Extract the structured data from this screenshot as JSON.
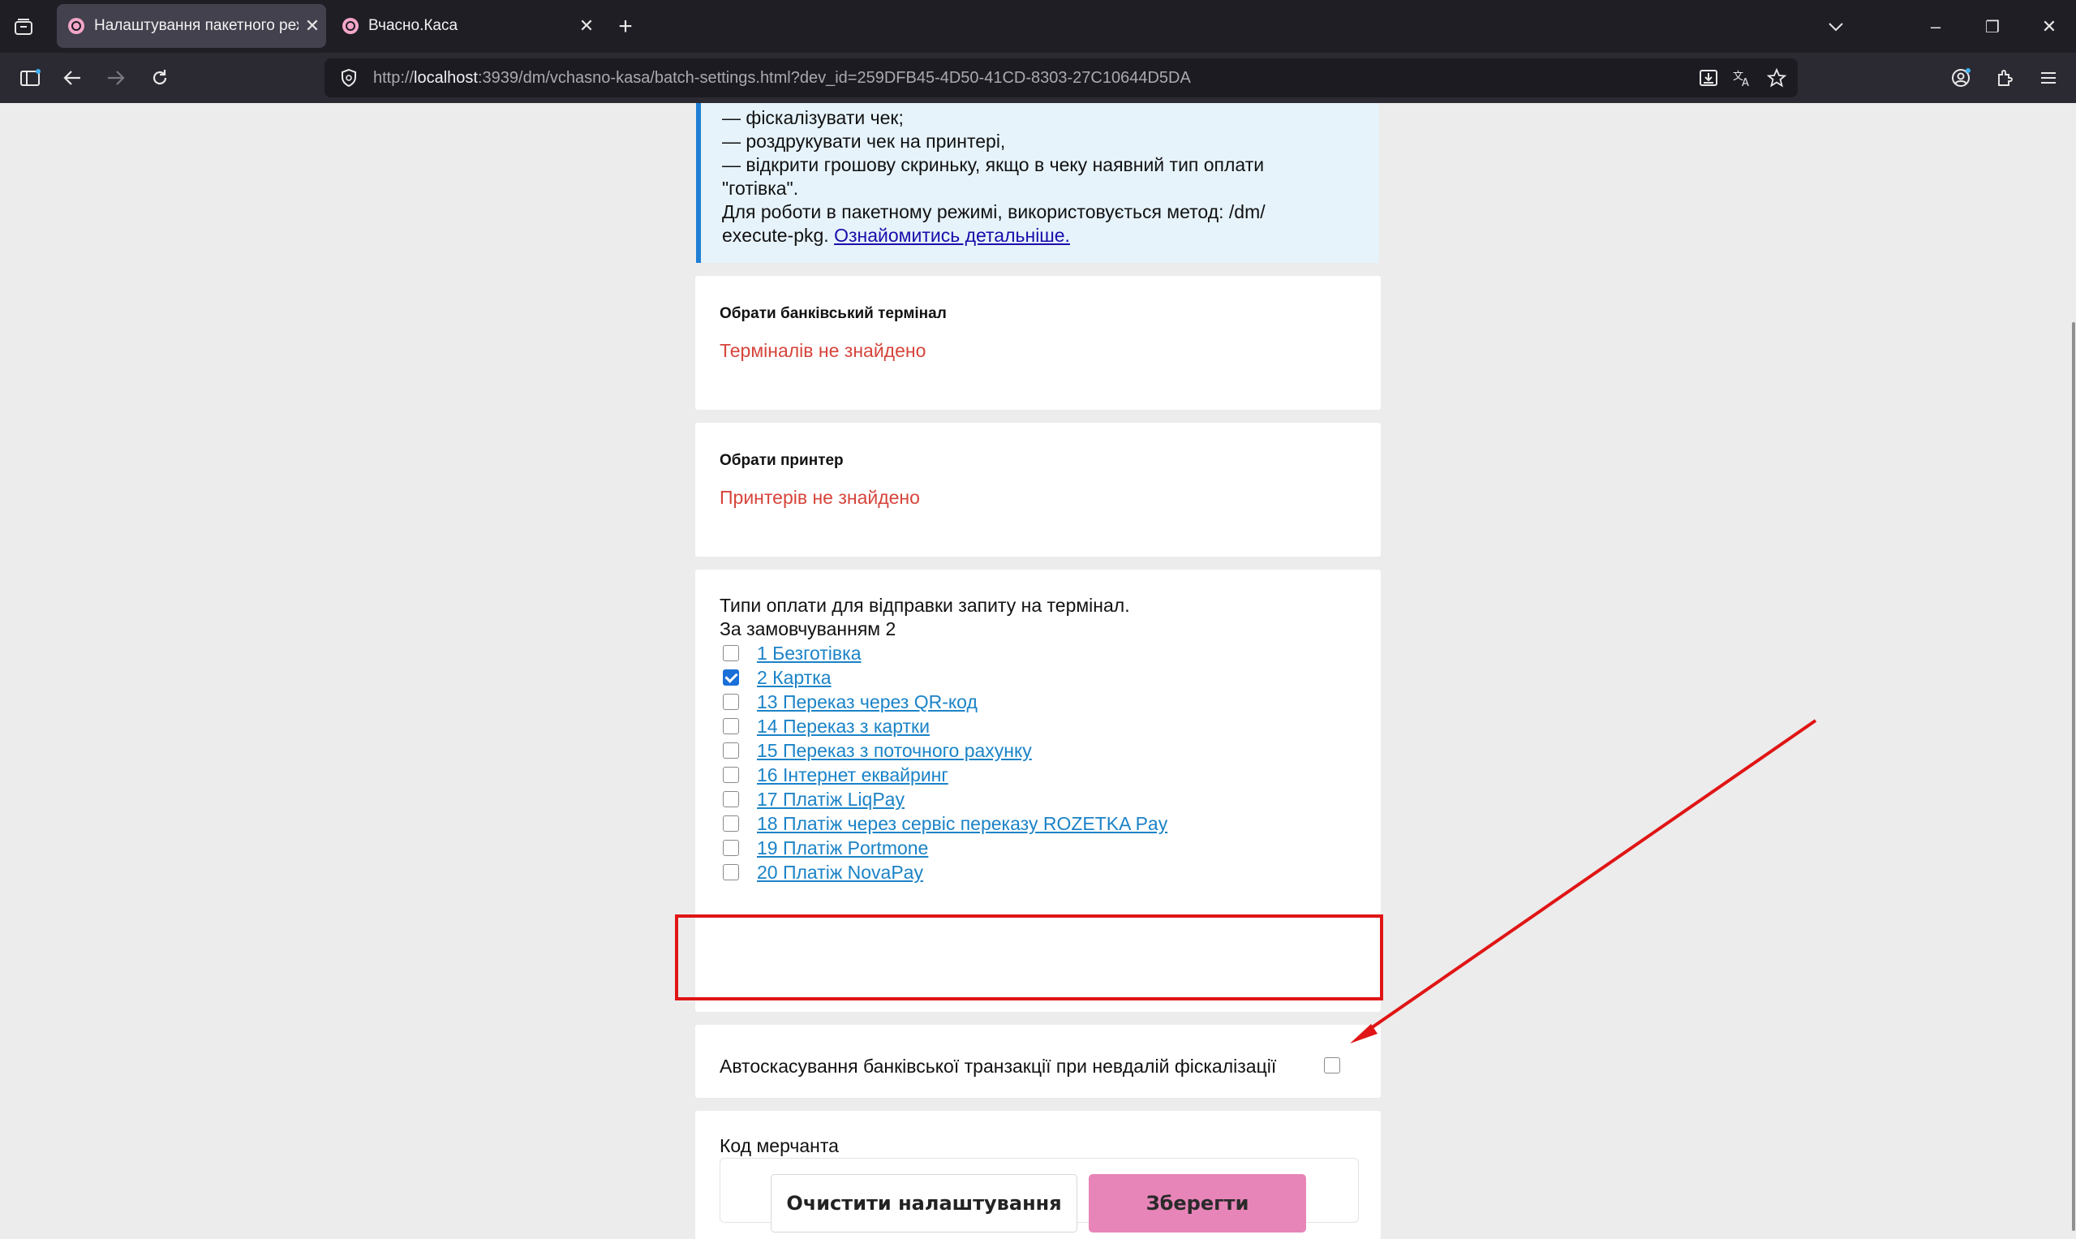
{
  "browser": {
    "tabs": [
      {
        "title": "Налаштування пакетного режи",
        "active": true
      },
      {
        "title": "Вчасно.Каса",
        "active": false
      }
    ],
    "new_tab_label": "+",
    "url": {
      "scheme": "http://",
      "host": "localhost",
      "rest": ":3939/dm/vchasno-kasa/batch-settings.html?dev_id=259DFB45-4D50-41CD-8303-27C10644D5DA"
    },
    "window_controls": {
      "minimize": "–",
      "restore": "❐",
      "close": "✕"
    }
  },
  "info": {
    "lines": [
      "— фіскалізувати чек;",
      "— роздрукувати чек на принтері,",
      "— відкрити грошову скриньку, якщо в чеку наявний тип оплати",
      "\"готівка\".",
      "Для роботи в пакетному режимі, використовується метод: /dm/"
    ],
    "last_line_prefix": "execute-pkg. ",
    "link_label": "Ознайомитись детальніше."
  },
  "terminal": {
    "title": "Обрати банківський термінал",
    "empty_message": "Терміналів не знайдено"
  },
  "printer": {
    "title": "Обрати принтер",
    "empty_message": "Принтерів не знайдено"
  },
  "payment_types": {
    "heading": "Типи оплати для відправки запиту на термінал.",
    "default_label": "За замовчуванням 2",
    "items": [
      {
        "label": "1 Безготівка",
        "checked": false
      },
      {
        "label": "2 Картка",
        "checked": true
      },
      {
        "label": "13 Переказ через QR-код",
        "checked": false
      },
      {
        "label": "14 Переказ з картки",
        "checked": false
      },
      {
        "label": "15 Переказ з поточного рахунку",
        "checked": false
      },
      {
        "label": "16 Інтернет еквайринг",
        "checked": false
      },
      {
        "label": "17 Платіж LiqPay",
        "checked": false
      },
      {
        "label": "18 Платіж через сервіс переказу ROZETKA Pay",
        "checked": false
      },
      {
        "label": "19 Платіж Portmone",
        "checked": false
      },
      {
        "label": "20 Платіж NovaPay",
        "checked": false
      }
    ]
  },
  "auto_cancel": {
    "label": "Автоскасування банківської транзакції при невдалій фіскалізації",
    "checked": false
  },
  "merchant": {
    "label": "Код мерчанта",
    "value": ""
  },
  "buttons": {
    "clear_label": "Очистити налаштування",
    "save_label": "Зберегти"
  },
  "colors": {
    "accent_pink": "#e785b8",
    "error_red": "#d6443b",
    "link_blue": "#1b83c7",
    "annotation_red": "#e01515",
    "info_border": "#1f7fd4"
  }
}
